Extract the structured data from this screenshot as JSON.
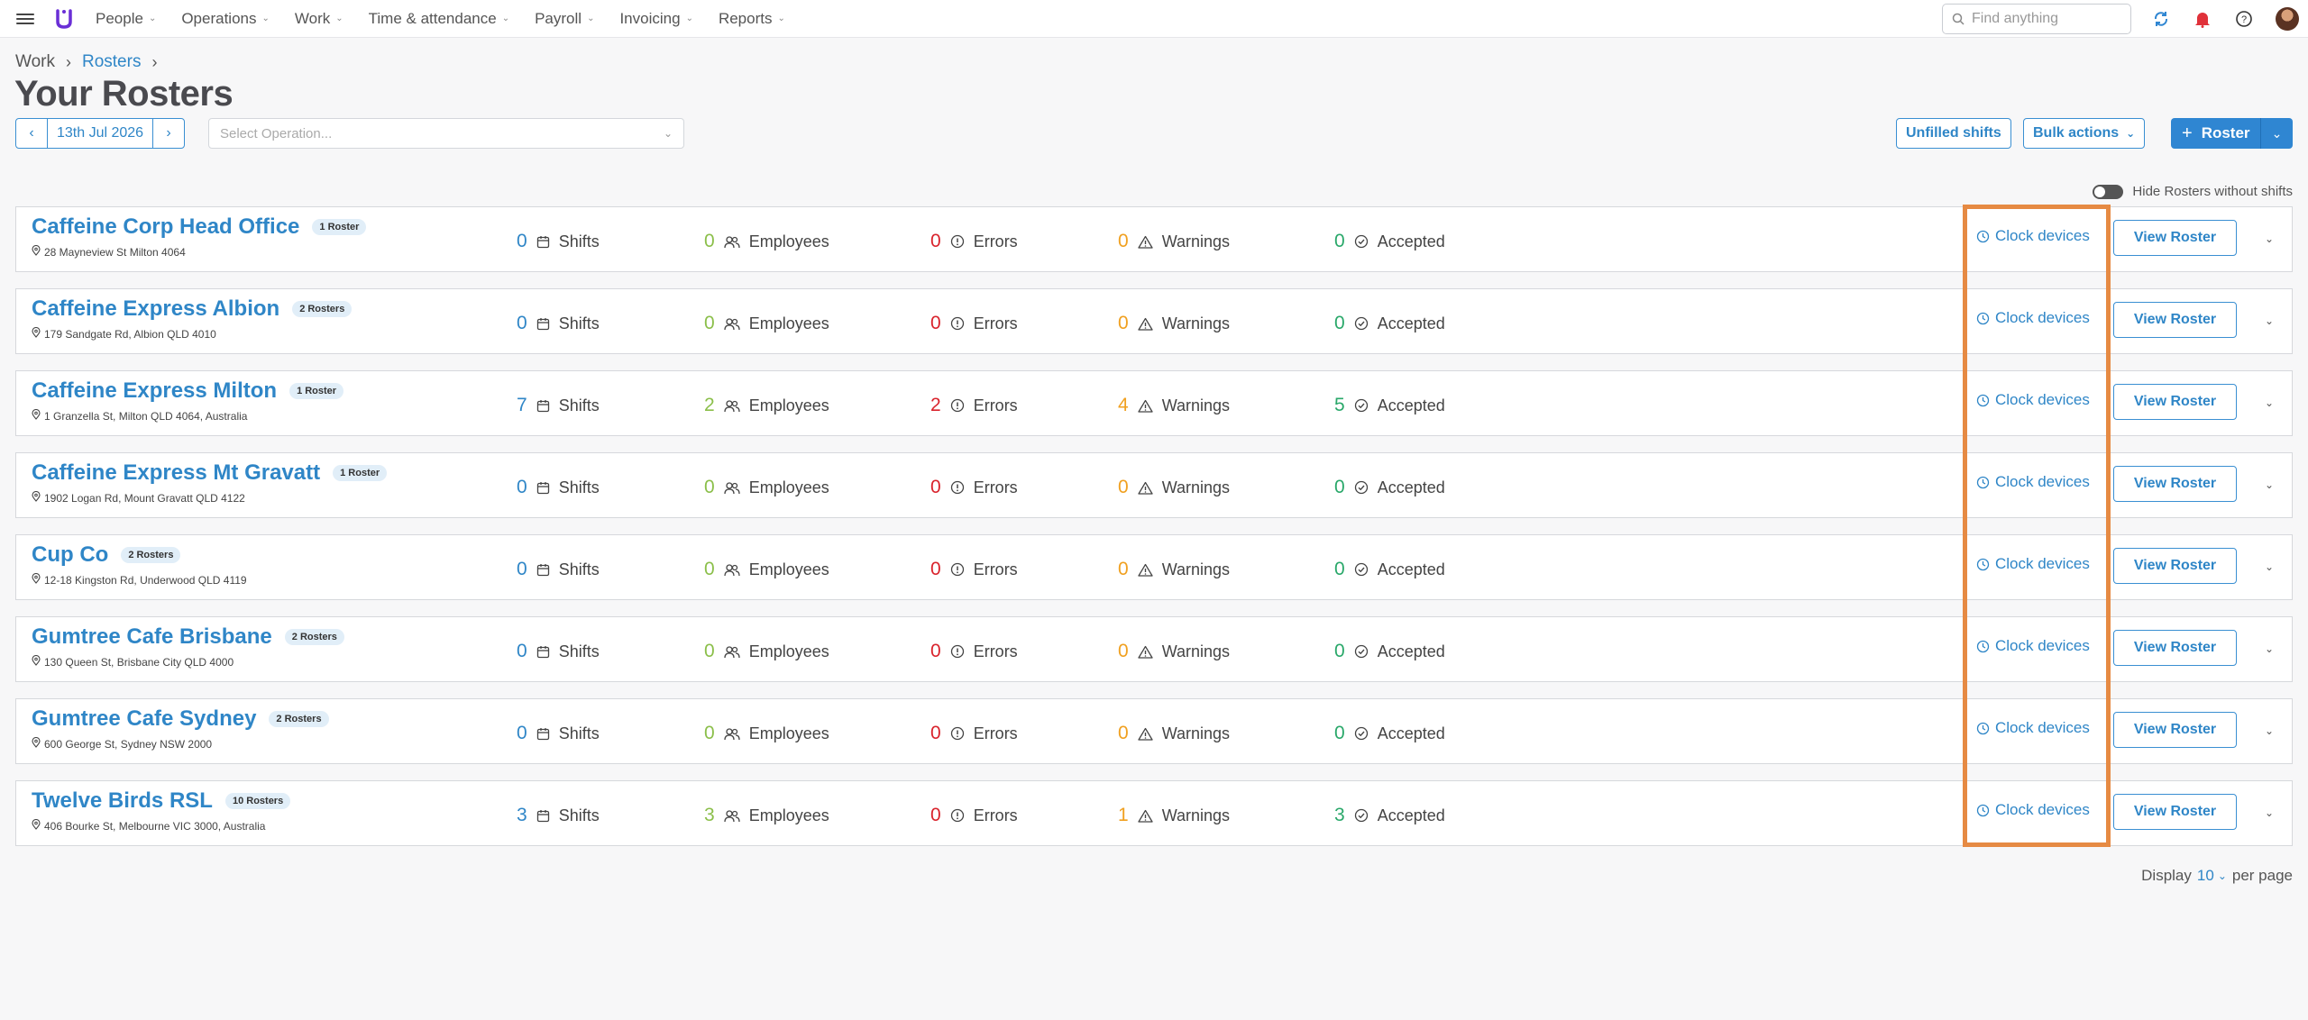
{
  "nav": {
    "items": [
      {
        "label": "People"
      },
      {
        "label": "Operations"
      },
      {
        "label": "Work"
      },
      {
        "label": "Time & attendance"
      },
      {
        "label": "Payroll"
      },
      {
        "label": "Invoicing"
      },
      {
        "label": "Reports"
      }
    ],
    "search_placeholder": "Find anything"
  },
  "breadcrumb": {
    "work": "Work",
    "rosters": "Rosters"
  },
  "page_title": "Your Rosters",
  "controls": {
    "date": "13th Jul 2026",
    "operation_placeholder": "Select Operation...",
    "unfilled_label": "Unfilled shifts",
    "bulk_label": "Bulk actions",
    "roster_label": "Roster",
    "hide_toggle_label": "Hide Rosters without shifts"
  },
  "labels": {
    "shifts": "Shifts",
    "employees": "Employees",
    "errors": "Errors",
    "warnings": "Warnings",
    "accepted": "Accepted",
    "clock_devices": "Clock devices",
    "view_roster": "View Roster"
  },
  "rosters": [
    {
      "name": "Caffeine Corp Head Office",
      "badge": "1 Roster",
      "address": "28 Mayneview St Milton 4064",
      "shifts": "0",
      "employees": "0",
      "errors": "0",
      "warnings": "0",
      "accepted": "0"
    },
    {
      "name": "Caffeine Express Albion",
      "badge": "2 Rosters",
      "address": "179 Sandgate Rd, Albion QLD 4010",
      "shifts": "0",
      "employees": "0",
      "errors": "0",
      "warnings": "0",
      "accepted": "0"
    },
    {
      "name": "Caffeine Express Milton",
      "badge": "1 Roster",
      "address": "1 Granzella St, Milton QLD 4064, Australia",
      "shifts": "7",
      "employees": "2",
      "errors": "2",
      "warnings": "4",
      "accepted": "5"
    },
    {
      "name": "Caffeine Express Mt Gravatt",
      "badge": "1 Roster",
      "address": "1902 Logan Rd, Mount Gravatt QLD 4122",
      "shifts": "0",
      "employees": "0",
      "errors": "0",
      "warnings": "0",
      "accepted": "0"
    },
    {
      "name": "Cup Co",
      "badge": "2 Rosters",
      "address": "12-18 Kingston Rd, Underwood QLD 4119",
      "shifts": "0",
      "employees": "0",
      "errors": "0",
      "warnings": "0",
      "accepted": "0"
    },
    {
      "name": "Gumtree Cafe Brisbane",
      "badge": "2 Rosters",
      "address": "130 Queen St, Brisbane City QLD 4000",
      "shifts": "0",
      "employees": "0",
      "errors": "0",
      "warnings": "0",
      "accepted": "0"
    },
    {
      "name": "Gumtree Cafe Sydney",
      "badge": "2 Rosters",
      "address": "600 George St, Sydney NSW 2000",
      "shifts": "0",
      "employees": "0",
      "errors": "0",
      "warnings": "0",
      "accepted": "0"
    },
    {
      "name": "Twelve Birds RSL",
      "badge": "10 Rosters",
      "address": "406 Bourke St, Melbourne VIC 3000, Australia",
      "shifts": "3",
      "employees": "3",
      "errors": "0",
      "warnings": "1",
      "accepted": "3"
    }
  ],
  "pager": {
    "prefix": "Display",
    "value": "10",
    "suffix": "per page"
  },
  "colors": {
    "accent": "#2f86c7",
    "highlight": "#e68a43"
  }
}
